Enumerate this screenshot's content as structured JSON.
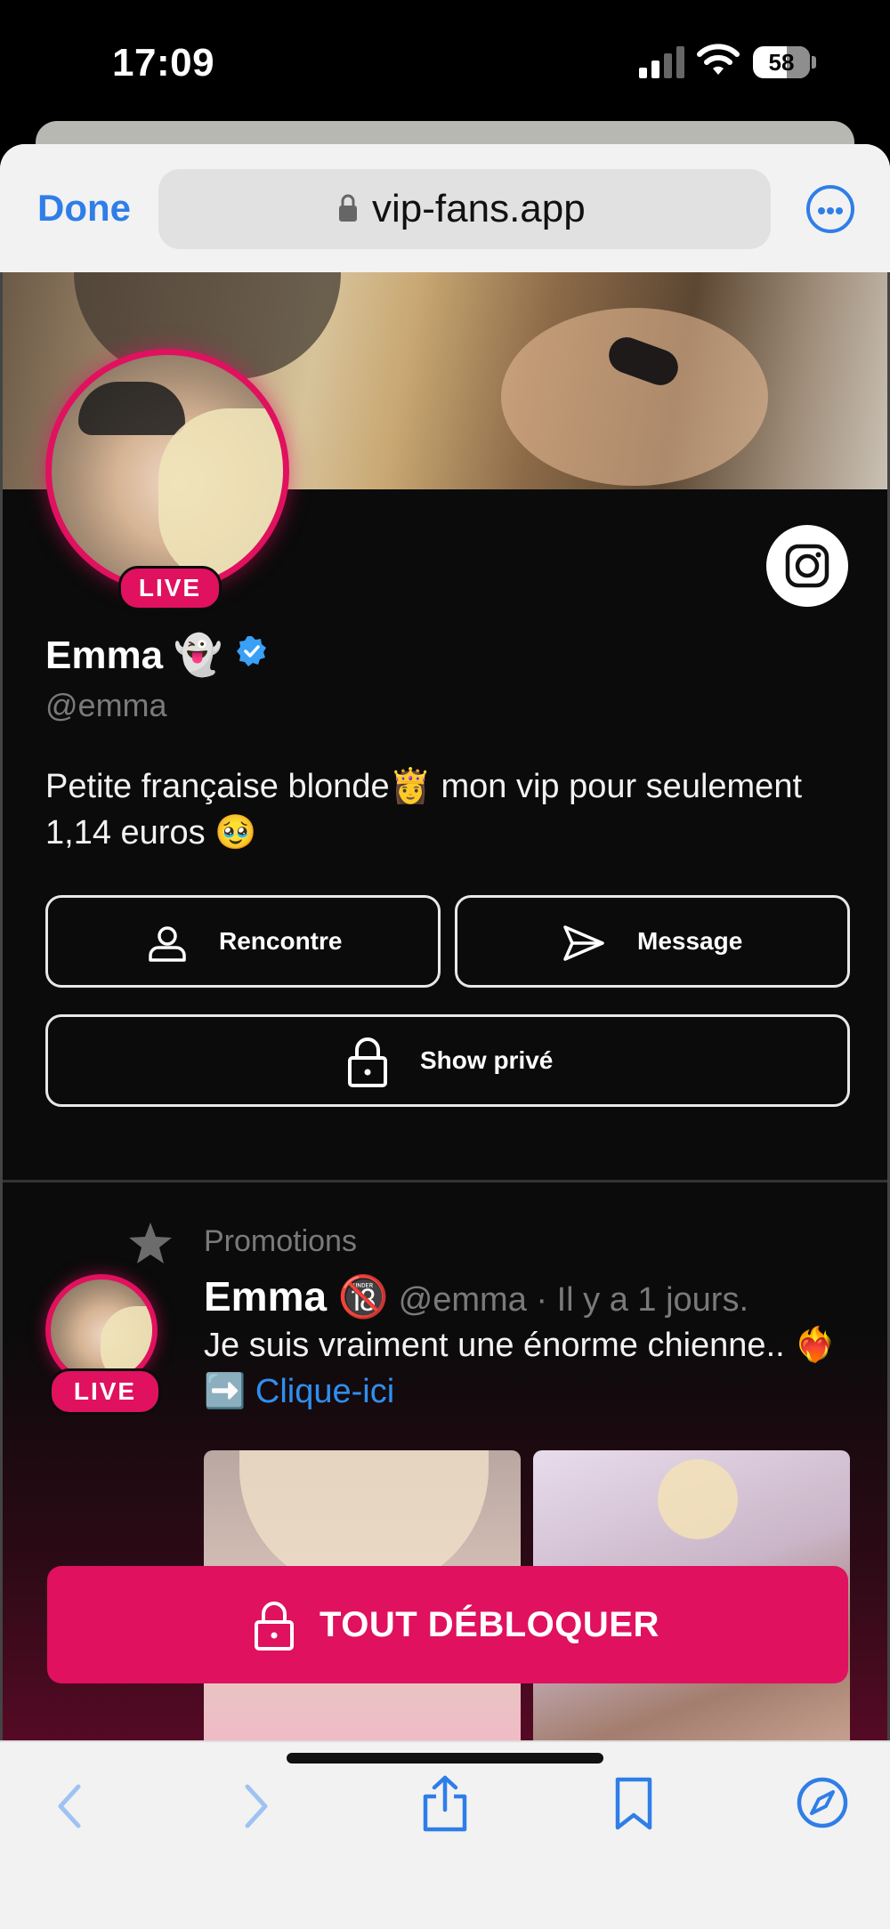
{
  "status": {
    "time": "17:09",
    "battery": "58"
  },
  "browser": {
    "done_label": "Done",
    "url": "vip-fans.app",
    "more_icon": "ellipsis-circle-icon",
    "accent": "#2f7ee8"
  },
  "profile": {
    "live_label": "LIVE",
    "name": "Emma 👻",
    "handle": "@emma",
    "bio": "Petite française blonde👸  mon vip pour seulement 1,14 euros 🥹",
    "buttons": {
      "meet": "Rencontre",
      "message": "Message",
      "private_show": "Show privé"
    },
    "accent": "#e0115f"
  },
  "post": {
    "section_label": "Promotions",
    "author_name": "Emma 🔞",
    "meta": " @emma · Il y a 1 jours.",
    "live_label": "LIVE",
    "text": "Je suis vraiment une énorme chienne.. ❤️‍🔥 ➡️ ",
    "link": "Clique-ici"
  },
  "cta": {
    "unlock_label": "TOUT DÉBLOQUER"
  },
  "toolbar": {
    "items": [
      "back-icon",
      "forward-icon",
      "share-icon",
      "bookmarks-icon",
      "compass-icon"
    ]
  }
}
